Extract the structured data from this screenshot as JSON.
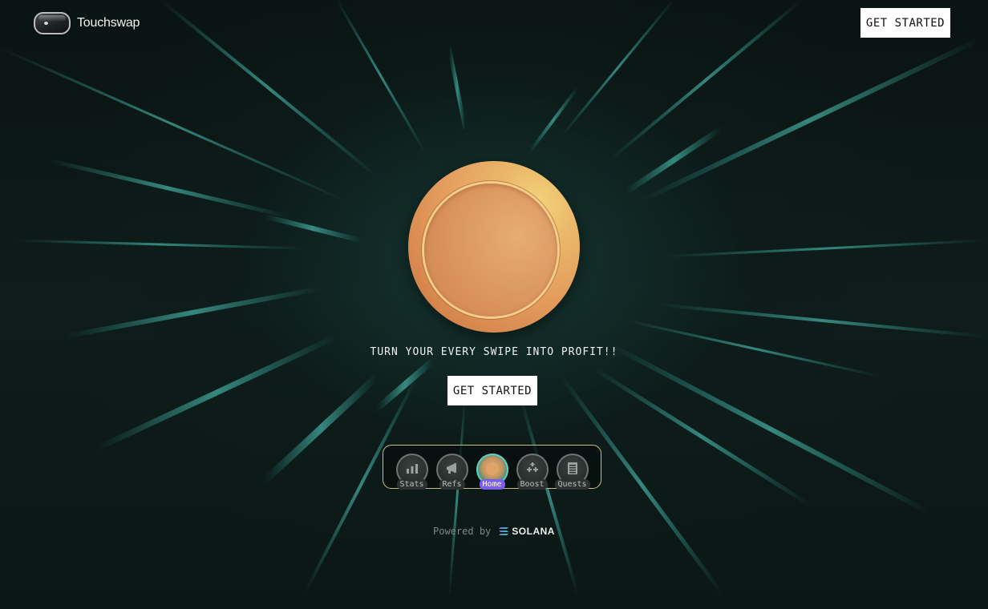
{
  "header": {
    "brand_name": "Touchswap",
    "cta_label": "GET STARTED"
  },
  "hero": {
    "tagline": "TURN YOUR EVERY SWIPE INTO PROFIT!!",
    "cta_label": "GET STARTED"
  },
  "nav": {
    "items": [
      {
        "label": "Stats",
        "icon": "bar-chart-icon",
        "active": false
      },
      {
        "label": "Refs",
        "icon": "megaphone-icon",
        "active": false
      },
      {
        "label": "Home",
        "icon": "coin-icon",
        "active": true
      },
      {
        "label": "Boost",
        "icon": "gamepad-icon",
        "active": false
      },
      {
        "label": "Quests",
        "icon": "list-icon",
        "active": false
      }
    ]
  },
  "footer": {
    "powered_by": "Powered by",
    "partner": "SOLANA"
  },
  "colors": {
    "background": "#0b1614",
    "accent_teal": "#5ad1c4",
    "active_badge": "#7e5cf0",
    "dock_border": "#c9bd86",
    "coin": "#e39a5c"
  }
}
